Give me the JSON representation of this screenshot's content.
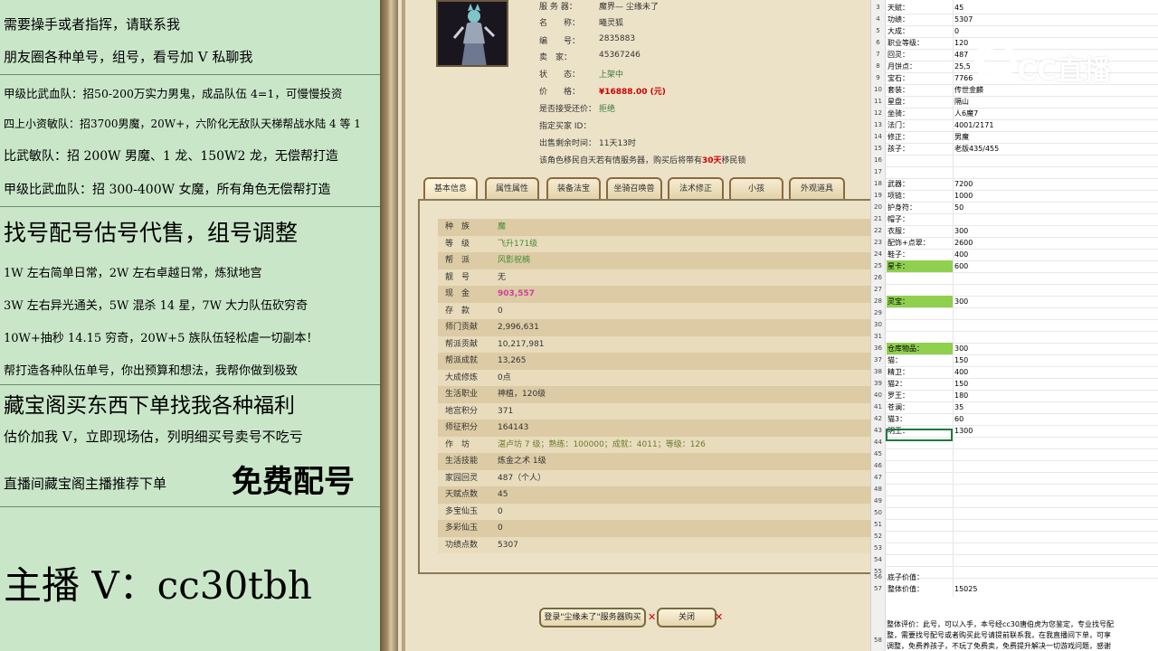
{
  "promo": {
    "lines": [
      "需要操手或者指挥，请联系我",
      "朋友圈各种单号，组号，看号加 V 私聊我",
      "甲级比武血队：招50-200万实力男鬼，成品队伍 4=1，可慢慢投资",
      "四上小资敏队：招3700男魔，20W+，六阶化无敌队天梯帮战水陆 4 等 1",
      "比武敏队：招 200W 男魔、1 龙、150W2 龙，无偿帮打造",
      "甲级比武血队：招 300-400W 女魔，所有角色无偿帮打造",
      "找号配号估号代售，组号调整",
      "1W 左右简单日常，2W 左右卓越日常，炼狱地宫",
      "3W 左右异光通关，5W 混杀 14 星，7W 大力队伍砍穷奇",
      "10W+抽秒 14.15 穷奇，20W+5 族队伍轻松虐一切副本！",
      "帮打造各种队伍单号，你出预算和想法，我帮你做到极致",
      "藏宝阁买东西下单找我各种福利",
      "估价加我 V，立即现场估，列明细买号卖号不吃亏",
      "直播间藏宝阁主播推荐下单"
    ],
    "big_free": "免费配号",
    "anchor": "主播 V：cc30tbh"
  },
  "game": {
    "top_info": [
      {
        "k": "服 务 器：",
        "v": "魔界— 尘缘未了"
      },
      {
        "k": "名　　称：",
        "v": "曦灵狐"
      },
      {
        "k": "编　　号：",
        "v": "2835883"
      },
      {
        "k": "卖　家：",
        "v": "45367246"
      },
      {
        "k": "状　　态：",
        "v": "上架中"
      },
      {
        "k": "价　　格：",
        "v": "¥16888.00 (元)"
      },
      {
        "k": "是否接受还价：",
        "v": "拒绝"
      },
      {
        "k": "指定买家 ID：",
        "v": ""
      },
      {
        "k": "出售剩余时间：",
        "v": "11天13时"
      }
    ],
    "desc_a": "该角色移民自天若有情服务器，购买后将带有",
    "desc_red": "30天",
    "desc_b": "移民锁",
    "tabs": [
      "基本信息",
      "属性属性",
      "装备法宝",
      "坐骑召唤兽",
      "法术修正",
      "小孩",
      "外观道具"
    ],
    "rows": [
      {
        "k": "种　族",
        "v": "魔",
        "c": "green"
      },
      {
        "k": "等　级",
        "v": "飞升171级",
        "c": "green"
      },
      {
        "k": "帮　派",
        "v": "风影祝楠",
        "c": "green"
      },
      {
        "k": "靓　号",
        "v": "无",
        "c": ""
      },
      {
        "k": "现　金",
        "v": "903,557",
        "c": "pink"
      },
      {
        "k": "存　款",
        "v": "0",
        "c": ""
      },
      {
        "k": "师门贡献",
        "v": "2,996,631",
        "c": ""
      },
      {
        "k": "帮派贡献",
        "v": "10,217,981",
        "c": ""
      },
      {
        "k": "帮派成就",
        "v": "13,265",
        "c": ""
      },
      {
        "k": "大成修炼",
        "v": "0点",
        "c": ""
      },
      {
        "k": "生活职业",
        "v": "神植，120级",
        "c": ""
      },
      {
        "k": "地宫积分",
        "v": "371",
        "c": ""
      },
      {
        "k": "师征积分",
        "v": "164143",
        "c": ""
      },
      {
        "k": "作　坊",
        "v": "湛卢坊 7 级；熟练：100000；成就：4011；等级：126",
        "c": "olive"
      },
      {
        "k": "生活技能",
        "v": "炼金之术 1级",
        "c": ""
      },
      {
        "k": "家园回灵",
        "v": "487（个人）",
        "c": ""
      },
      {
        "k": "天赋点数",
        "v": "45",
        "c": ""
      },
      {
        "k": "多宝仙玉",
        "v": "0",
        "c": ""
      },
      {
        "k": "多彩仙玉",
        "v": "0",
        "c": ""
      },
      {
        "k": "功绩点数",
        "v": "5307",
        "c": ""
      }
    ],
    "buy_button": "登录\"尘缘未了\"服务器购买",
    "close_button": "关闭",
    "x_mark": "✕"
  },
  "sheet": {
    "rows": [
      {
        "n": "3",
        "a": "天赋：",
        "b": "45"
      },
      {
        "n": "4",
        "a": "功绩：",
        "b": "5307"
      },
      {
        "n": "5",
        "a": "大成：",
        "b": "0"
      },
      {
        "n": "6",
        "a": "职业等级：",
        "b": "120"
      },
      {
        "n": "7",
        "a": "回灵：",
        "b": "487"
      },
      {
        "n": "8",
        "a": "月饼点：",
        "b": "25,5"
      },
      {
        "n": "9",
        "a": "宝石：",
        "b": "7766"
      },
      {
        "n": "10",
        "a": "套装：",
        "b": "传世金麟"
      },
      {
        "n": "11",
        "a": "星盘：",
        "b": "隔山"
      },
      {
        "n": "12",
        "a": "坐骑：",
        "b": "人6魔7"
      },
      {
        "n": "13",
        "a": "法门：",
        "b": "4001/2171"
      },
      {
        "n": "14",
        "a": "修正：",
        "b": "男魔"
      },
      {
        "n": "15",
        "a": "孩子：",
        "b": "老版435/455"
      },
      {
        "n": "16",
        "a": "",
        "b": ""
      },
      {
        "n": "17",
        "a": "",
        "b": ""
      },
      {
        "n": "18",
        "a": "武器：",
        "b": "7200"
      },
      {
        "n": "19",
        "a": "项链：",
        "b": "1000"
      },
      {
        "n": "20",
        "a": "护身符：",
        "b": "50"
      },
      {
        "n": "21",
        "a": "帽子：",
        "b": ""
      },
      {
        "n": "22",
        "a": "衣服：",
        "b": "300"
      },
      {
        "n": "23",
        "a": "配饰+点翠：",
        "b": "2600"
      },
      {
        "n": "24",
        "a": "鞋子：",
        "b": "400"
      },
      {
        "n": "25",
        "a": "星卡：",
        "b": "600",
        "hl": true
      },
      {
        "n": "26",
        "a": "",
        "b": ""
      },
      {
        "n": "27",
        "a": "",
        "b": ""
      },
      {
        "n": "28",
        "a": "灵宝：",
        "b": "300",
        "hl": true
      },
      {
        "n": "29",
        "a": "",
        "b": ""
      },
      {
        "n": "30",
        "a": "",
        "b": ""
      },
      {
        "n": "31",
        "a": "",
        "b": ""
      },
      {
        "n": "36",
        "a": "仓库物品：",
        "b": "300",
        "hl": true
      },
      {
        "n": "37",
        "a": "猫：",
        "b": "150"
      },
      {
        "n": "38",
        "a": "精卫：",
        "b": "400"
      },
      {
        "n": "39",
        "a": "猫2：",
        "b": "150"
      },
      {
        "n": "40",
        "a": "罗王：",
        "b": "180"
      },
      {
        "n": "41",
        "a": "苍澜：",
        "b": "35"
      },
      {
        "n": "42",
        "a": "猫3：",
        "b": "60"
      },
      {
        "n": "43",
        "a": "明王：",
        "b": "1300"
      },
      {
        "n": "44",
        "a": "",
        "b": ""
      },
      {
        "n": "45",
        "a": "",
        "b": ""
      },
      {
        "n": "46",
        "a": "",
        "b": ""
      },
      {
        "n": "47",
        "a": "",
        "b": ""
      },
      {
        "n": "48",
        "a": "",
        "b": ""
      },
      {
        "n": "49",
        "a": "",
        "b": ""
      },
      {
        "n": "50",
        "a": "",
        "b": ""
      },
      {
        "n": "51",
        "a": "",
        "b": ""
      },
      {
        "n": "52",
        "a": "",
        "b": ""
      },
      {
        "n": "53",
        "a": "",
        "b": ""
      },
      {
        "n": "54",
        "a": "",
        "b": ""
      },
      {
        "n": "55",
        "a": "",
        "b": ""
      }
    ],
    "tail_rows": [
      {
        "n": "56",
        "a": "底子价值：",
        "b": ""
      },
      {
        "n": "57",
        "a": "整体价值：",
        "b": "15025"
      }
    ],
    "eval_1": "整体评价：此号，可以入手，本号经cc30唐伯虎为您鉴定，专业找号配",
    "eval_2": "整，需要找号配号或者购买此号请提前联系我，在我直播间下单，可享",
    "eval_3": "调整，免费养孩子，不玩了免费卖，免费提升解决一切游戏问题，感谢",
    "row_58": "58"
  },
  "logo": {
    "text": "CC直播"
  },
  "colors": {
    "promo_bg": "#c9e6c9",
    "highlight": "#8fd04e",
    "price_red": "#cc0000"
  }
}
